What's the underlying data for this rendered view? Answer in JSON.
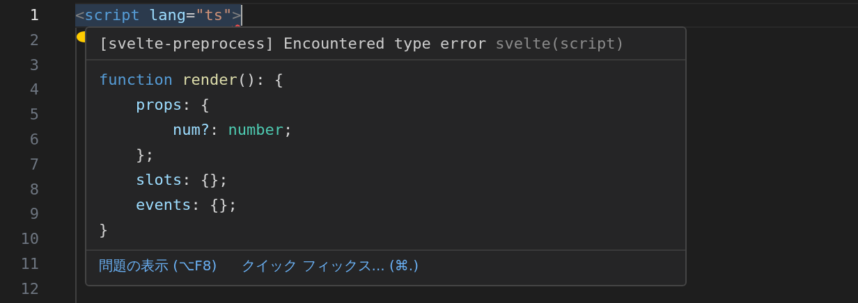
{
  "editor": {
    "line_numbers": [
      {
        "number": "1",
        "current": true
      },
      {
        "number": "2",
        "current": false
      },
      {
        "number": "3",
        "current": false
      },
      {
        "number": "4",
        "current": false
      },
      {
        "number": "5",
        "current": false
      },
      {
        "number": "6",
        "current": false
      },
      {
        "number": "7",
        "current": false
      },
      {
        "number": "8",
        "current": false
      },
      {
        "number": "9",
        "current": false
      },
      {
        "number": "10",
        "current": false
      },
      {
        "number": "11",
        "current": false
      },
      {
        "number": "12",
        "current": false
      }
    ],
    "first_line": [
      {
        "text": "<",
        "kind": "punct"
      },
      {
        "text": "script",
        "kind": "tag"
      },
      {
        "text": " lang",
        "kind": "attr"
      },
      {
        "text": "=",
        "kind": "plain"
      },
      {
        "text": "\"ts\"",
        "kind": "string"
      },
      {
        "text": ">",
        "kind": "punct",
        "error": true
      }
    ]
  },
  "hover": {
    "message": "[svelte-preprocess] Encountered type error",
    "source": "svelte(script)",
    "code": [
      [
        {
          "text": "function",
          "kind": "keyword"
        },
        {
          "text": " render",
          "kind": "func"
        },
        {
          "text": "(): {",
          "kind": "plain"
        }
      ],
      [
        {
          "text": "    props",
          "kind": "prop"
        },
        {
          "text": ": {",
          "kind": "plain"
        }
      ],
      [
        {
          "text": "        num?",
          "kind": "prop"
        },
        {
          "text": ": ",
          "kind": "plain"
        },
        {
          "text": "number",
          "kind": "type"
        },
        {
          "text": ";",
          "kind": "plain"
        }
      ],
      [
        {
          "text": "    };",
          "kind": "plain"
        }
      ],
      [
        {
          "text": "    slots",
          "kind": "prop"
        },
        {
          "text": ": {};",
          "kind": "plain"
        }
      ],
      [
        {
          "text": "    events",
          "kind": "prop"
        },
        {
          "text": ": {};",
          "kind": "plain"
        }
      ],
      [
        {
          "text": "}",
          "kind": "plain"
        }
      ]
    ],
    "actions": [
      "問題の表示 (⌥F8)",
      "クイック フィックス... (⌘.)"
    ]
  }
}
